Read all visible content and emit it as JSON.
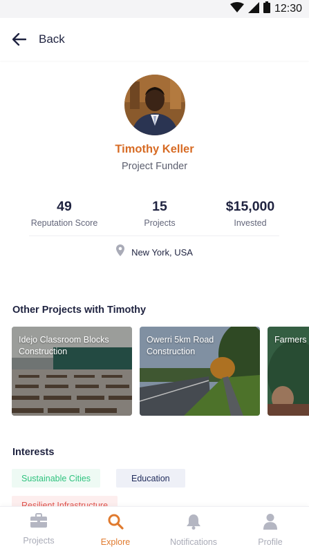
{
  "status_bar": {
    "time": "12:30"
  },
  "header": {
    "back_label": "Back"
  },
  "profile": {
    "name": "Timothy Keller",
    "role": "Project Funder",
    "stats": [
      {
        "value": "49",
        "label": "Reputation Score"
      },
      {
        "value": "15",
        "label": "Projects"
      },
      {
        "value": "$15,000",
        "label": "Invested"
      }
    ],
    "location": "New York, USA"
  },
  "other_projects": {
    "title": "Other Projects with Timothy",
    "cards": [
      {
        "label": "Idejo Classroom Blocks Construction"
      },
      {
        "label": "Owerri 5km Road Construction"
      },
      {
        "label": "Farmers Program"
      }
    ]
  },
  "interests": {
    "title": "Interests",
    "tags": [
      {
        "label": "Sustainable Cities",
        "color": "#2ec27e"
      },
      {
        "label": "Education",
        "color": "#1e2a5a"
      },
      {
        "label": "Resilient Infrastructure",
        "color": "#e0554f"
      }
    ]
  },
  "bottom_nav": {
    "items": [
      {
        "label": "Projects",
        "icon": "briefcase-icon",
        "active": false
      },
      {
        "label": "Explore",
        "icon": "search-icon",
        "active": true
      },
      {
        "label": "Notifications",
        "icon": "bell-icon",
        "active": false
      },
      {
        "label": "Profile",
        "icon": "person-icon",
        "active": false
      }
    ]
  },
  "colors": {
    "accent": "#e07a2e",
    "name": "#d76b24",
    "text_primary": "#1f2340",
    "inactive": "#a9abb7"
  }
}
